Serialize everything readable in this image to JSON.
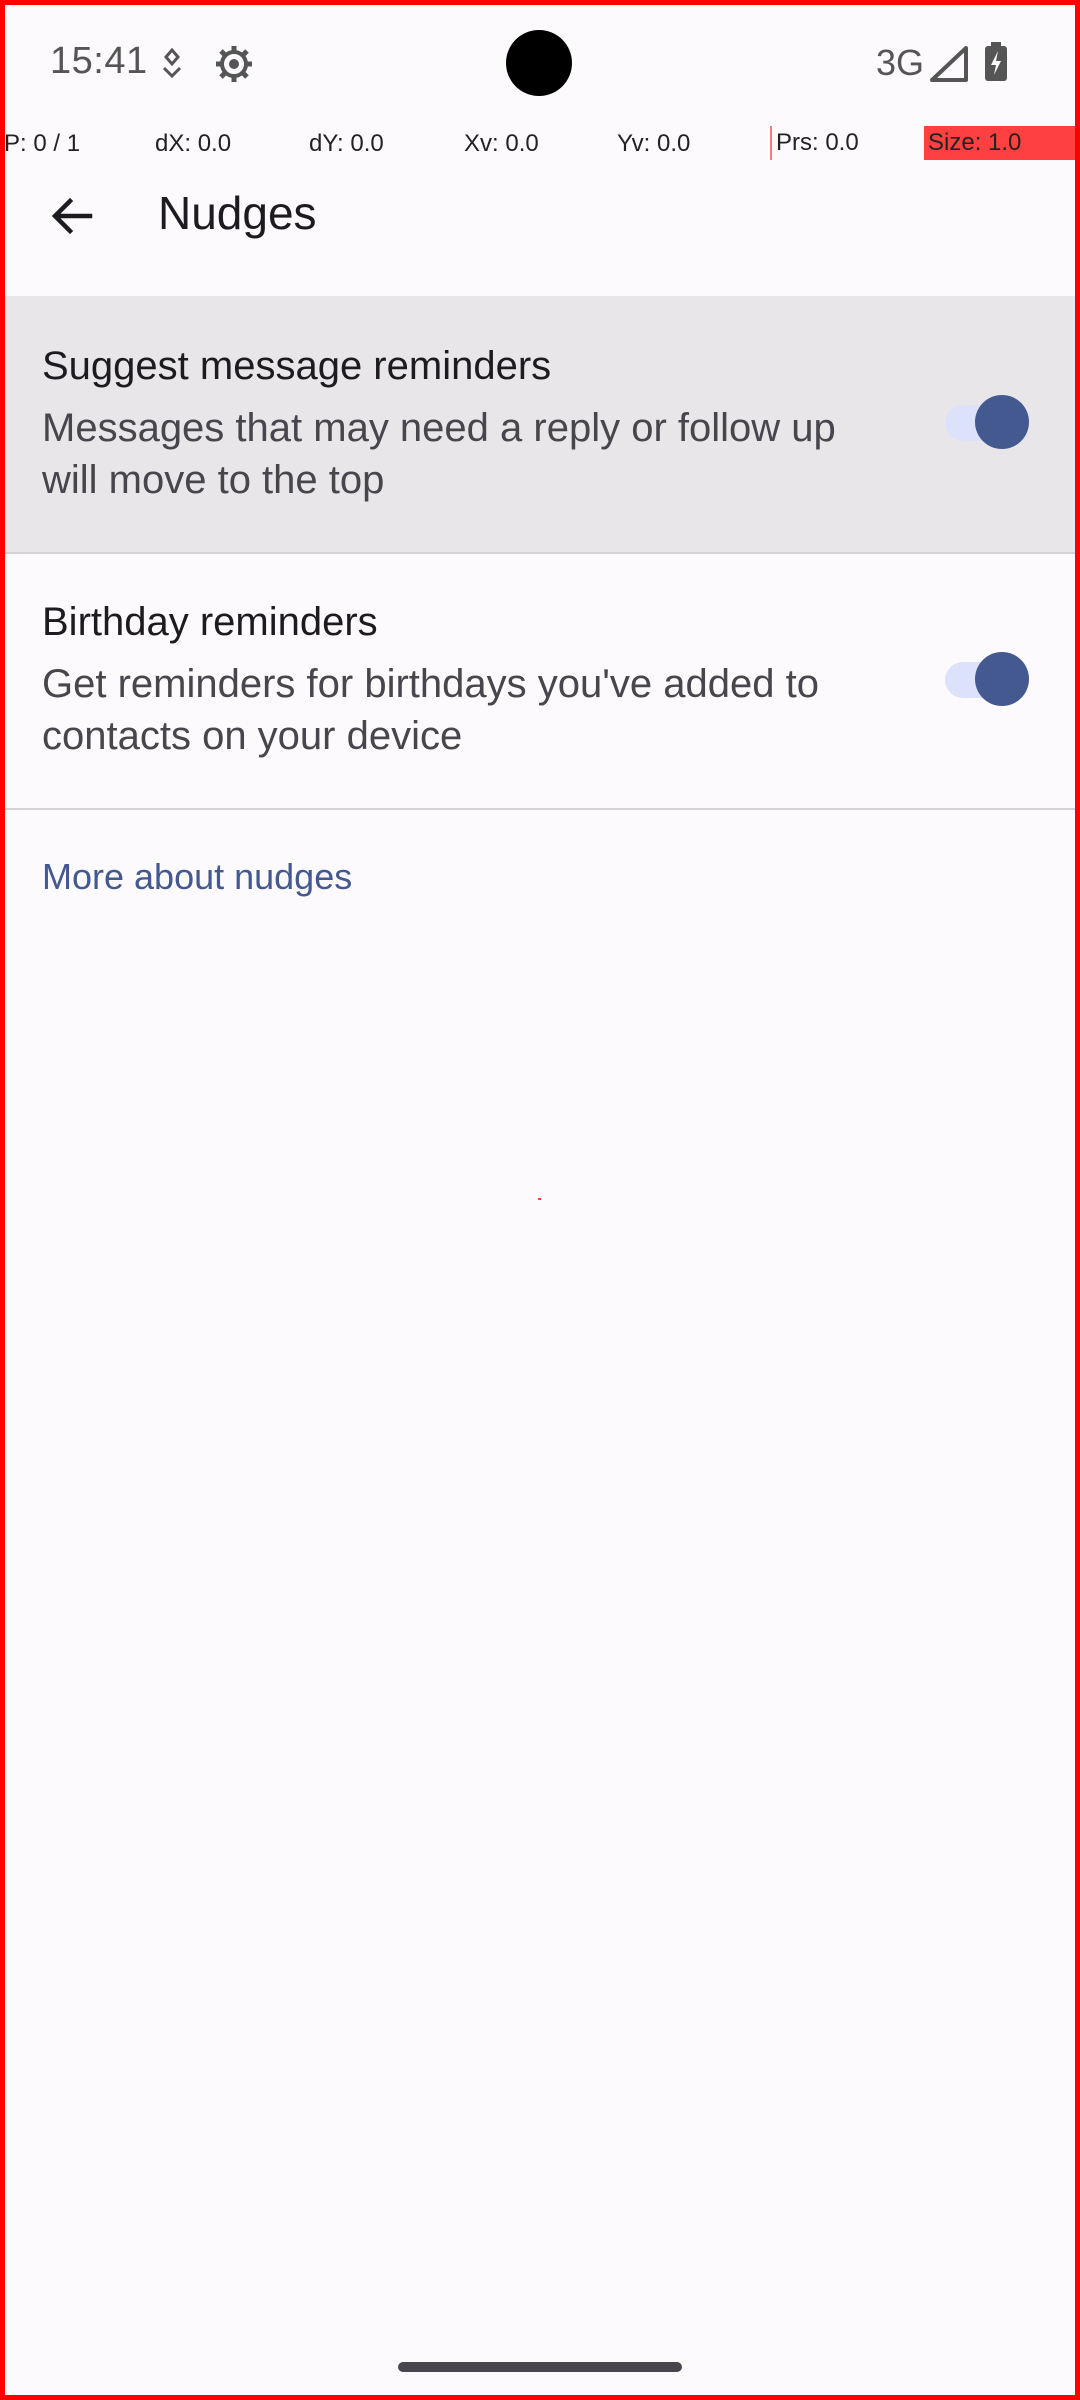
{
  "status_bar": {
    "time": "15:41",
    "network": "3G",
    "icons": [
      "location-icon",
      "settings-gear-icon",
      "signal-icon",
      "battery-charging-icon"
    ]
  },
  "pointer_overlay": {
    "p": "P: 0 / 1",
    "dx": "dX: 0.0",
    "dy": "dY: 0.0",
    "xv": "Xv: 0.0",
    "yv": "Yv: 0.0",
    "prs": "Prs: 0.0",
    "size": "Size: 1.0"
  },
  "app_bar": {
    "title": "Nudges",
    "back_icon": "arrow-back-icon"
  },
  "settings": [
    {
      "title": "Suggest message reminders",
      "summary": "Messages that may need a reply or follow up will move to the top",
      "enabled": true
    },
    {
      "title": "Birthday reminders",
      "summary": "Get reminders for birthdays you've added to contacts on your device",
      "enabled": true
    }
  ],
  "more_link": "More about nudges",
  "colors": {
    "accent": "#44598f",
    "toggle_track": "#dde2fb",
    "background": "#fdfafe",
    "pressed_row": "#e8e6e9"
  }
}
